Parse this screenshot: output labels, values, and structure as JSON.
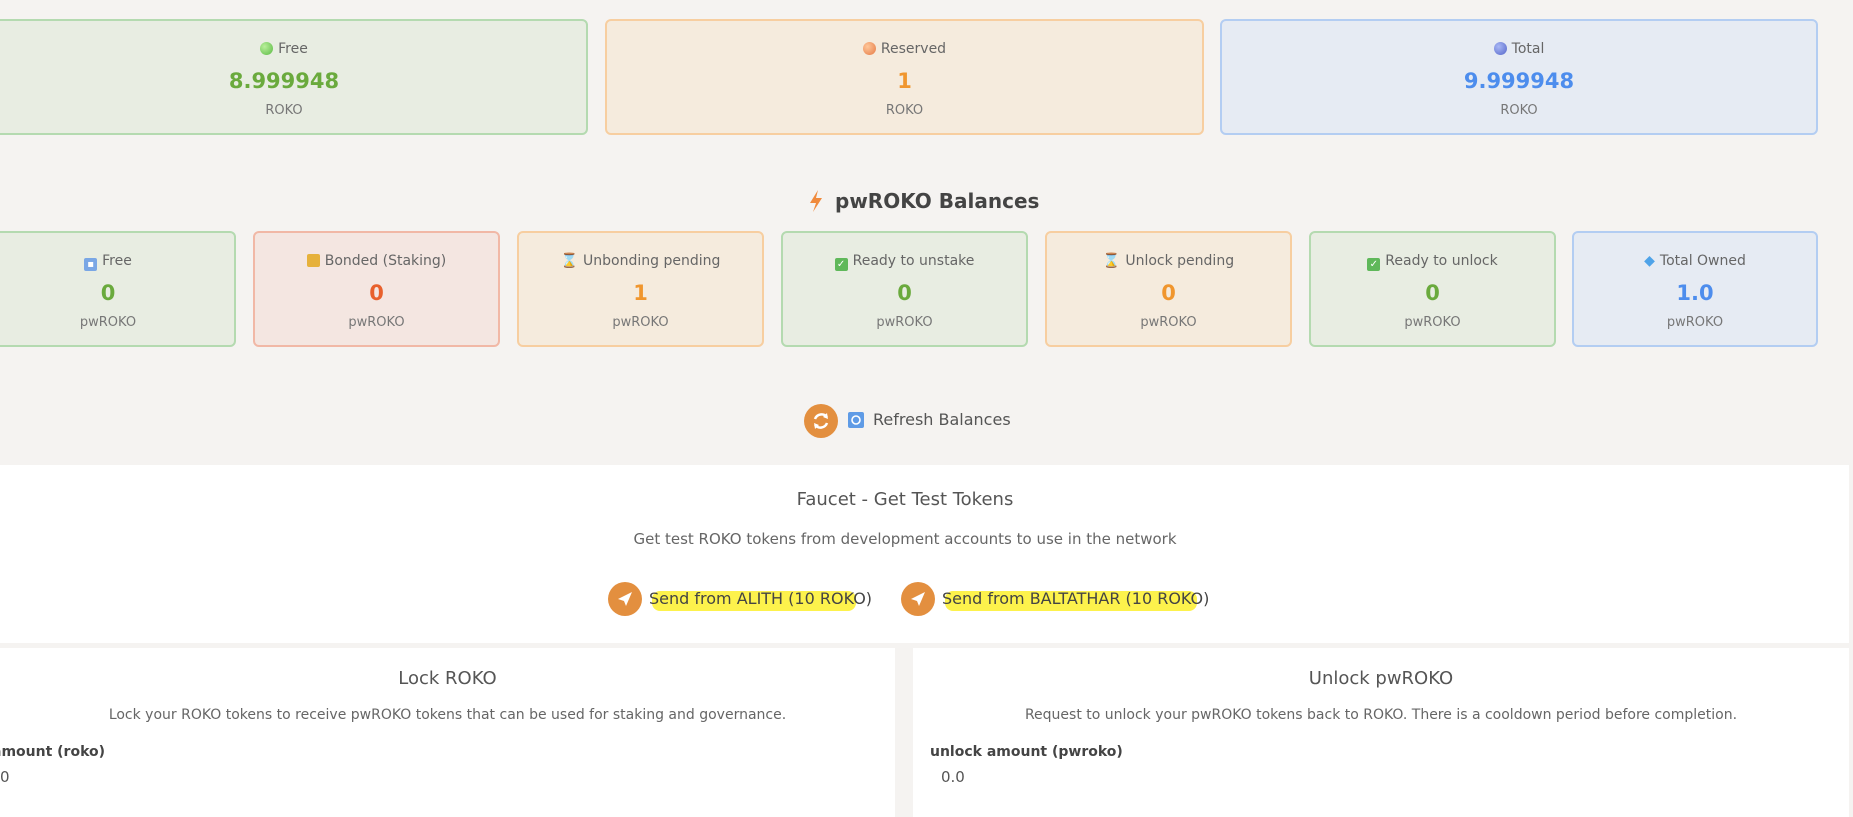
{
  "roko_balances": [
    {
      "label": "Free",
      "value": "8.999948",
      "unit": "ROKO",
      "color": "#6aaa3d"
    },
    {
      "label": "Reserved",
      "value": "1",
      "unit": "ROKO",
      "color": "#f0962e"
    },
    {
      "label": "Total",
      "value": "9.999948",
      "unit": "ROKO",
      "color": "#4d8ded"
    }
  ],
  "pwroko": {
    "title": "pwROKO Balances",
    "cards": [
      {
        "label": "Free",
        "value": "0",
        "unit": "pwROKO",
        "icon": "free-icon"
      },
      {
        "label": "Bonded (Staking)",
        "value": "0",
        "unit": "pwROKO",
        "icon": "lock-icon"
      },
      {
        "label": "Unbonding pending",
        "value": "1",
        "unit": "pwROKO",
        "icon": "hourglass-icon"
      },
      {
        "label": "Ready to unstake",
        "value": "0",
        "unit": "pwROKO",
        "icon": "check-icon"
      },
      {
        "label": "Unlock pending",
        "value": "0",
        "unit": "pwROKO",
        "icon": "hourglass-icon"
      },
      {
        "label": "Ready to unlock",
        "value": "0",
        "unit": "pwROKO",
        "icon": "check-icon"
      },
      {
        "label": "Total Owned",
        "value": "1.0",
        "unit": "pwROKO",
        "icon": "diamond-icon"
      }
    ]
  },
  "refresh": {
    "label": "Refresh Balances"
  },
  "faucet": {
    "title": "Faucet - Get Test Tokens",
    "subtitle": "Get test ROKO tokens from development accounts to use in the network",
    "buttons": [
      {
        "label": "Send from ALITH (10 ROKO)"
      },
      {
        "label": "Send from BALTATHAR (10 ROKO)"
      }
    ]
  },
  "lock": {
    "title": "Lock ROKO",
    "subtitle": "Lock your ROKO tokens to receive pwROKO tokens that can be used for staking and governance.",
    "field_label": "amount (roko)",
    "field_value": "0"
  },
  "unlock": {
    "title": "Unlock pwROKO",
    "subtitle": "Request to unlock your pwROKO tokens back to ROKO. There is a cooldown period before completion.",
    "field_label": "unlock amount (pwroko)",
    "field_value": "0.0"
  }
}
